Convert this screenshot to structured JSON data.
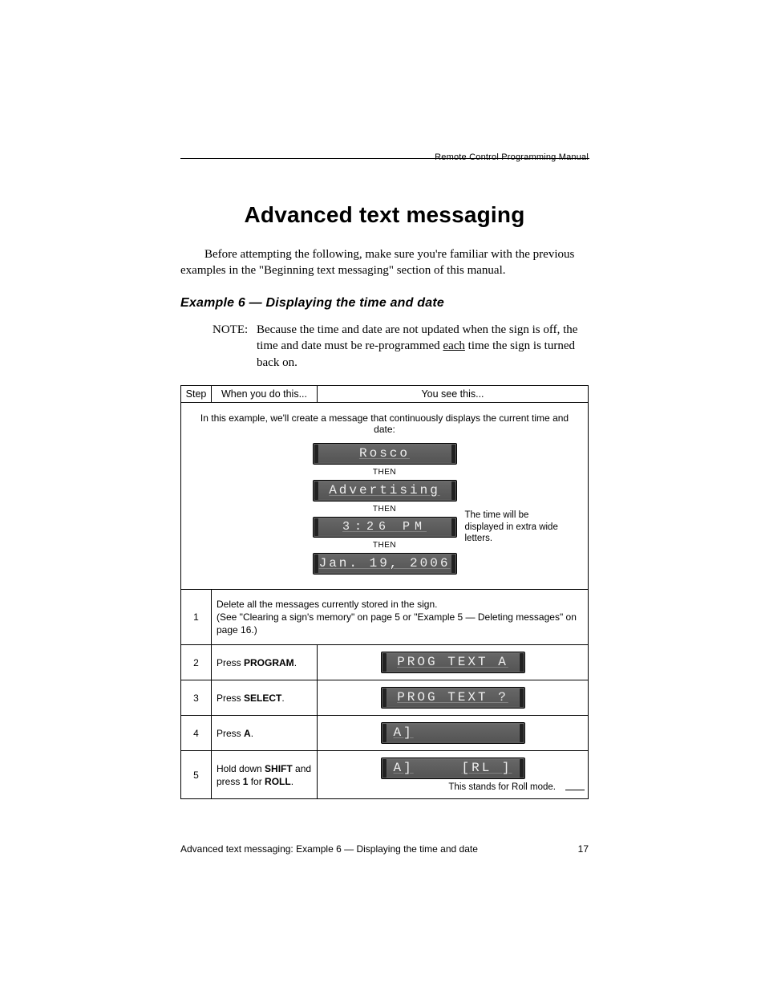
{
  "header": {
    "running_title": "Remote Control Programming Manual"
  },
  "title": "Advanced text messaging",
  "intro": "Before attempting the following, make sure you're familiar with the previous examples in the \"Beginning text messaging\" section of this manual.",
  "example_heading": "Example 6 — Displaying the time and date",
  "note": {
    "label": "NOTE:",
    "text_before": "Because the time and date are not updated when the sign is off, the time and date must be re-programmed ",
    "underlined": "each",
    "text_after": " time the sign is turned back on."
  },
  "table": {
    "headers": {
      "step": "Step",
      "action": "When you do this...",
      "result": "You see this..."
    },
    "intro_line": "In this example, we'll create a message that continuously displays the current time and date:",
    "then_label": "THEN",
    "lcd_sequence": {
      "line1": "Rosco",
      "line2": "Advertising",
      "line3": "3:26 PM",
      "line4": "Jan. 19, 2006"
    },
    "time_annotation": "The time will be displayed in extra wide letters.",
    "rows": {
      "r1": {
        "num": "1",
        "action": "Delete all the messages currently stored in the sign.",
        "action_sub": "(See \"Clearing a sign's memory\" on page 5 or \"Example 5 — Deleting messages\" on page 16.)"
      },
      "r2": {
        "num": "2",
        "action_pre": "Press ",
        "action_bold": "PROGRAM",
        "action_post": ".",
        "lcd": "PROG TEXT A"
      },
      "r3": {
        "num": "3",
        "action_pre": "Press ",
        "action_bold": "SELECT",
        "action_post": ".",
        "lcd": "PROG TEXT ?"
      },
      "r4": {
        "num": "4",
        "action_pre": "Press ",
        "action_bold": "A",
        "action_post": ".",
        "lcd": "A]"
      },
      "r5": {
        "num": "5",
        "action_pre": "Hold down ",
        "action_bold1": "SHIFT",
        "action_mid": " and press ",
        "action_bold2": "1",
        "action_mid2": " for ",
        "action_bold3": "ROLL",
        "action_post": ".",
        "lcd_left": "A]",
        "lcd_right": "[RL ]",
        "annotation": "This stands for Roll mode."
      }
    }
  },
  "footer": {
    "left": "Advanced text messaging: Example 6 — Displaying the time and date",
    "right": "17"
  }
}
